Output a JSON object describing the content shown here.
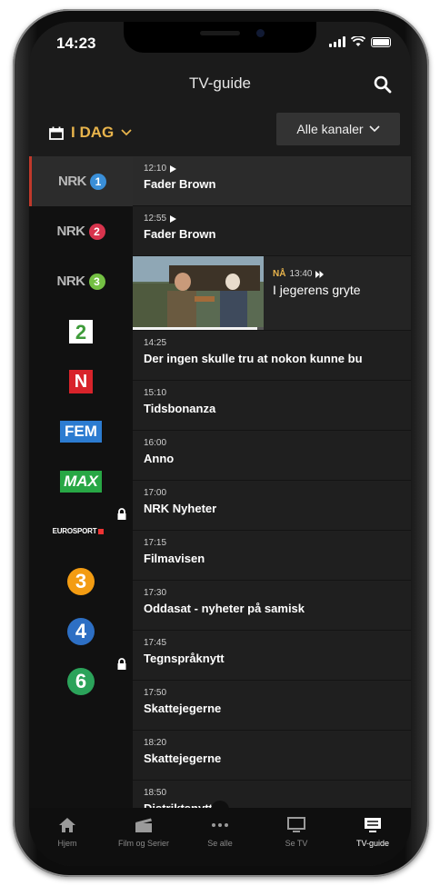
{
  "status": {
    "time": "14:23"
  },
  "header": {
    "title": "TV-guide"
  },
  "filter": {
    "day_label": "I DAG",
    "channels_label": "Alle kanaler"
  },
  "channels": [
    {
      "name": "NRK1",
      "logo": "NRK",
      "number": "1",
      "color": "#3a8fd8",
      "locked": false,
      "active": true
    },
    {
      "name": "NRK2",
      "logo": "NRK",
      "number": "2",
      "color": "#d8344d",
      "locked": false,
      "active": false
    },
    {
      "name": "NRK3",
      "logo": "NRK",
      "number": "3",
      "color": "#74c043",
      "locked": false,
      "active": false
    },
    {
      "name": "TV 2",
      "logo": "2",
      "locked": false
    },
    {
      "name": "TVNorge",
      "logo": "N",
      "locked": false
    },
    {
      "name": "FEM",
      "logo": "FEM",
      "locked": false
    },
    {
      "name": "MAX",
      "logo": "MAX",
      "locked": false
    },
    {
      "name": "Eurosport",
      "logo": "EUROSPORT",
      "locked": true
    },
    {
      "name": "TV3",
      "logo": "3",
      "locked": false
    },
    {
      "name": "TV4",
      "logo": "4",
      "locked": false
    },
    {
      "name": "TV6",
      "logo": "6",
      "locked": true
    }
  ],
  "programs": [
    {
      "time": "12:10",
      "title": "Fader Brown",
      "play_icon": "play-icon"
    },
    {
      "time": "12:55",
      "title": "Fader Brown",
      "play_icon": "play-icon"
    },
    {
      "now_label": "NÅ",
      "time": "13:40",
      "title": "I jegerens gryte",
      "live": true,
      "progress": 0.95,
      "icon": "live-icon"
    },
    {
      "time": "14:25",
      "title": "Der ingen skulle tru at nokon kunne bu"
    },
    {
      "time": "15:10",
      "title": "Tidsbonanza"
    },
    {
      "time": "16:00",
      "title": "Anno"
    },
    {
      "time": "17:00",
      "title": "NRK Nyheter"
    },
    {
      "time": "17:15",
      "title": "Filmavisen"
    },
    {
      "time": "17:30",
      "title": "Oddasat - nyheter på samisk"
    },
    {
      "time": "17:45",
      "title": "Tegnspråknytt"
    },
    {
      "time": "17:50",
      "title": "Skattejegerne"
    },
    {
      "time": "18:20",
      "title": "Skattejegerne"
    },
    {
      "time": "18:50",
      "title": "Distriktsnytt"
    }
  ],
  "tabs": [
    {
      "label": "Hjem",
      "icon": "home-icon"
    },
    {
      "label": "Film og Serier",
      "icon": "clapperboard-icon"
    },
    {
      "label": "Se alle",
      "icon": "more-icon"
    },
    {
      "label": "Se TV",
      "icon": "tv-icon"
    },
    {
      "label": "TV-guide",
      "icon": "tv-guide-icon",
      "active": true
    }
  ],
  "colors": {
    "accent": "#e8b44c",
    "active_indicator": "#c0392b",
    "background": "#1b1b1b"
  }
}
